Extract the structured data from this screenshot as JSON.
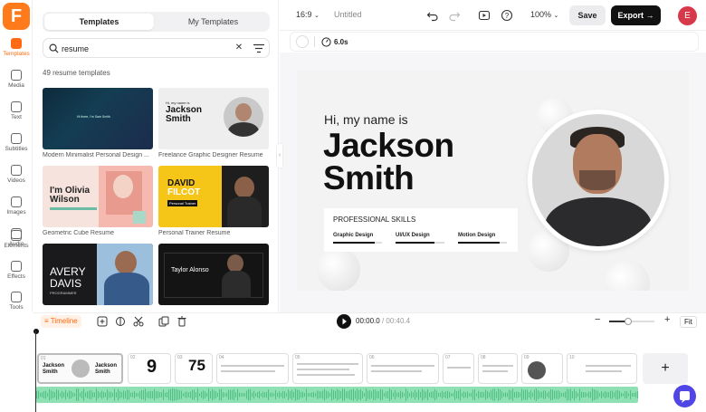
{
  "app": {
    "logo_letter": "F",
    "brand_color": "#ff6a13"
  },
  "rail": [
    {
      "label": "Templates",
      "icon": "templates-icon",
      "active": true
    },
    {
      "label": "Media",
      "icon": "media-icon"
    },
    {
      "label": "Text",
      "icon": "text-icon"
    },
    {
      "label": "Subtitles",
      "icon": "subtitles-icon"
    },
    {
      "label": "Videos",
      "icon": "videos-icon"
    },
    {
      "label": "Images",
      "icon": "images-icon"
    },
    {
      "label": "Audio",
      "icon": "audio-icon"
    },
    {
      "label": "Elements",
      "icon": "elements-icon"
    },
    {
      "label": "Effects",
      "icon": "effects-icon"
    },
    {
      "label": "Tools",
      "icon": "tools-icon"
    }
  ],
  "panel": {
    "tabs": {
      "templates": "Templates",
      "my_templates": "My Templates"
    },
    "search_value": "resume",
    "count_text": "49 resume templates",
    "templates": [
      {
        "label": "Modern Minimalist Personal Design ...",
        "thumb_text": "Hi there, I'm Sam Smith"
      },
      {
        "label": "Freelance Graphic Designer Resume",
        "thumb_text1": "Hi, my name is",
        "thumb_text2": "Jackson",
        "thumb_text3": "Smith"
      },
      {
        "label": "Geometric Cube Resume",
        "thumb_text1": "I'm Olivia",
        "thumb_text2": "Wilson"
      },
      {
        "label": "Personal Trainer Resume",
        "thumb_text1": "DAVID",
        "thumb_text2": "FILCOT",
        "thumb_text3": "Personal Trainer"
      },
      {
        "label": "",
        "thumb_text1": "AVERY",
        "thumb_text2": "DAVIS",
        "thumb_text3": "PROGRAMMER"
      },
      {
        "label": "",
        "thumb_text1": "Taylor Alonso"
      }
    ]
  },
  "topbar": {
    "ratio": "16:9",
    "doc_name": "Untitled",
    "zoom": "100%",
    "save_label": "Save",
    "export_label": "Export",
    "avatar_letter": "E"
  },
  "subbar": {
    "duration": "6.0s"
  },
  "slide": {
    "greeting": "Hi, my name is",
    "first_name": "Jackson",
    "last_name": "Smith",
    "skills_title": "PROFESSIONAL SKILLS",
    "skills": [
      {
        "name": "Graphic Design",
        "level": 0.85
      },
      {
        "name": "UI/UX Design",
        "level": 0.8
      },
      {
        "name": "Motion Design",
        "level": 0.85
      }
    ]
  },
  "timeline": {
    "label": "Timeline",
    "current_time": "00:00.0",
    "total_time": "/ 00:40.4",
    "fit_label": "Fit",
    "add_label": "+",
    "clip_numbers": [
      "01",
      "02",
      "03",
      "04",
      "05",
      "06",
      "07",
      "08",
      "09",
      "10",
      "11"
    ]
  }
}
